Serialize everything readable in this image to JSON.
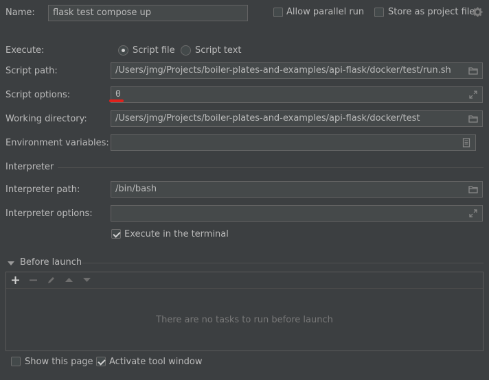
{
  "name": {
    "label": "Name:",
    "value": "flask test compose up"
  },
  "options": {
    "allow_parallel_label": "Allow parallel run",
    "store_as_project_label": "Store as project file"
  },
  "execute": {
    "label": "Execute:",
    "script_file_label": "Script file",
    "script_text_label": "Script text",
    "selected": "Script file"
  },
  "script_path": {
    "label": "Script path:",
    "value": "/Users/jmg/Projects/boiler-plates-and-examples/api-flask/docker/test/run.sh"
  },
  "script_options": {
    "label": "Script options:",
    "value": "0"
  },
  "working_directory": {
    "label": "Working directory:",
    "value": "/Users/jmg/Projects/boiler-plates-and-examples/api-flask/docker/test"
  },
  "env_vars": {
    "label": "Environment variables:",
    "value": ""
  },
  "interpreter": {
    "section_title": "Interpreter",
    "path_label": "Interpreter path:",
    "path_value": "/bin/bash",
    "options_label": "Interpreter options:",
    "options_value": "",
    "execute_in_terminal_label": "Execute in the terminal"
  },
  "before_launch": {
    "title": "Before launch",
    "empty_text": "There are no tasks to run before launch"
  },
  "footer": {
    "show_page_label": "Show this page",
    "activate_tool_window_label": "Activate tool window"
  },
  "colors": {
    "background": "#3c3f41",
    "field_background": "#45494a",
    "text": "#bbbbbb",
    "annotation_underline": "#e0201b"
  }
}
